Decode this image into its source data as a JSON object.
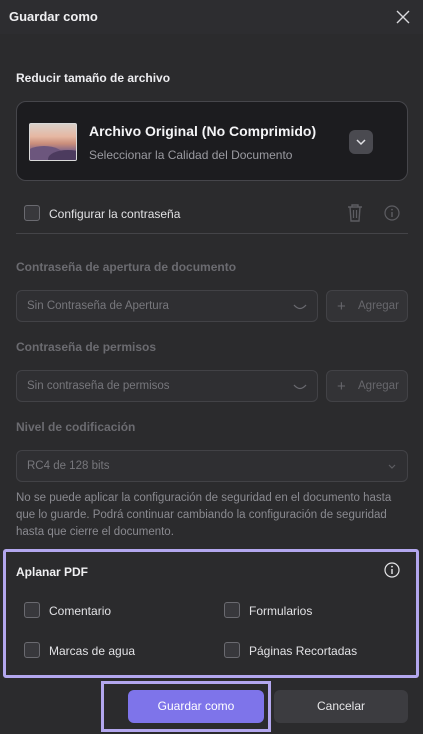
{
  "window": {
    "title": "Guardar como"
  },
  "compress": {
    "section_title": "Reducir tamaño de archivo",
    "file_title": "Archivo Original (No Comprimido)",
    "file_subtitle": "Seleccionar la Calidad del Documento"
  },
  "password": {
    "checkbox_label": "Configurar la contraseña",
    "checked": false,
    "open_title": "Contraseña de apertura de documento",
    "open_placeholder": "Sin Contraseña de Apertura",
    "open_add": "Agregar",
    "perm_title": "Contraseña de permisos",
    "perm_placeholder": "Sin contraseña de permisos",
    "perm_add": "Agregar",
    "enc_title": "Nivel de codificación",
    "enc_value": "RC4 de 128 bits",
    "note": "No se puede aplicar la configuración de seguridad en el documento hasta que lo guarde. Podrá continuar cambiando la configuración de seguridad hasta que cierre el documento."
  },
  "flatten": {
    "title": "Aplanar PDF",
    "options": [
      {
        "label": "Comentario",
        "checked": false
      },
      {
        "label": "Formularios",
        "checked": false
      },
      {
        "label": "Marcas de agua",
        "checked": false
      },
      {
        "label": "Páginas Recortadas",
        "checked": false
      }
    ]
  },
  "buttons": {
    "save": "Guardar como",
    "cancel": "Cancelar"
  },
  "colors": {
    "accent": "#7e74ea",
    "highlight": "#b3a7ee",
    "background": "#2b2b2d"
  }
}
